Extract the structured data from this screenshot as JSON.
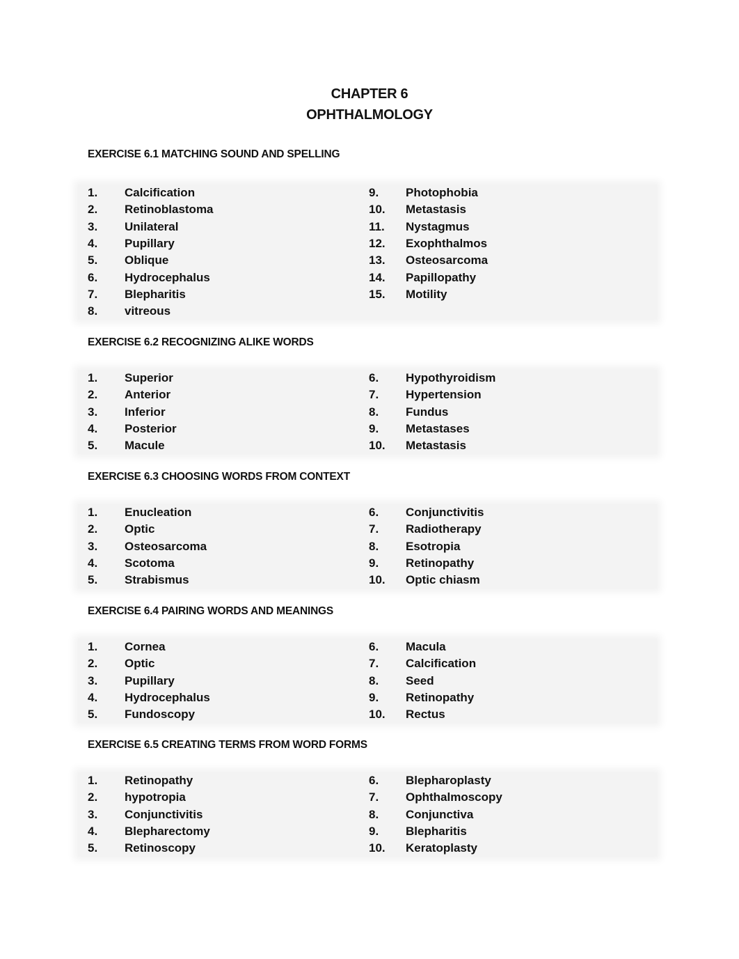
{
  "header": {
    "chapter": "CHAPTER 6",
    "subject": "OPHTHALMOLOGY"
  },
  "exercises": [
    {
      "title": "EXERCISE 6.1 MATCHING SOUND AND SPELLING",
      "left": [
        {
          "num": "1.",
          "term": "Calcification"
        },
        {
          "num": "2.",
          "term": "Retinoblastoma"
        },
        {
          "num": "3.",
          "term": "Unilateral"
        },
        {
          "num": "4.",
          "term": "Pupillary"
        },
        {
          "num": "5.",
          "term": "Oblique"
        },
        {
          "num": "6.",
          "term": "Hydrocephalus"
        },
        {
          "num": "7.",
          "term": "Blepharitis"
        },
        {
          "num": "8.",
          "term": "vitreous"
        }
      ],
      "right": [
        {
          "num": "9.",
          "term": "Photophobia"
        },
        {
          "num": "10.",
          "term": "Metastasis"
        },
        {
          "num": "11.",
          "term": "Nystagmus"
        },
        {
          "num": "12.",
          "term": "Exophthalmos"
        },
        {
          "num": "13.",
          "term": "Osteosarcoma"
        },
        {
          "num": "14.",
          "term": "Papillopathy"
        },
        {
          "num": "15.",
          "term": "Motility"
        },
        {
          "num": "",
          "term": ""
        }
      ]
    },
    {
      "title": "EXERCISE 6.2 RECOGNIZING ALIKE WORDS",
      "left": [
        {
          "num": "1.",
          "term": "Superior"
        },
        {
          "num": "2.",
          "term": "Anterior"
        },
        {
          "num": "3.",
          "term": "Inferior"
        },
        {
          "num": "4.",
          "term": "Posterior"
        },
        {
          "num": "5.",
          "term": "Macule"
        }
      ],
      "right": [
        {
          "num": "6.",
          "term": "Hypothyroidism"
        },
        {
          "num": "7.",
          "term": "Hypertension"
        },
        {
          "num": "8.",
          "term": "Fundus"
        },
        {
          "num": "9.",
          "term": "Metastases"
        },
        {
          "num": "10.",
          "term": "Metastasis"
        }
      ]
    },
    {
      "title": "EXERCISE 6.3 CHOOSING WORDS FROM CONTEXT",
      "left": [
        {
          "num": "1.",
          "term": "Enucleation"
        },
        {
          "num": "2.",
          "term": "Optic"
        },
        {
          "num": "3.",
          "term": "Osteosarcoma"
        },
        {
          "num": "4.",
          "term": "Scotoma"
        },
        {
          "num": "5.",
          "term": "Strabismus"
        }
      ],
      "right": [
        {
          "num": "6.",
          "term": "Conjunctivitis"
        },
        {
          "num": "7.",
          "term": "Radiotherapy"
        },
        {
          "num": "8.",
          "term": "Esotropia"
        },
        {
          "num": "9.",
          "term": "Retinopathy"
        },
        {
          "num": "10.",
          "term": "Optic chiasm"
        }
      ]
    },
    {
      "title": "EXERCISE 6.4 PAIRING WORDS AND MEANINGS",
      "left": [
        {
          "num": "1.",
          "term": "Cornea"
        },
        {
          "num": "2.",
          "term": "Optic"
        },
        {
          "num": "3.",
          "term": "Pupillary"
        },
        {
          "num": "4.",
          "term": "Hydrocephalus"
        },
        {
          "num": "5.",
          "term": "Fundoscopy"
        }
      ],
      "right": [
        {
          "num": "6.",
          "term": "Macula"
        },
        {
          "num": "7.",
          "term": "Calcification"
        },
        {
          "num": "8.",
          "term": "Seed"
        },
        {
          "num": "9.",
          "term": "Retinopathy"
        },
        {
          "num": "10.",
          "term": "Rectus"
        }
      ]
    },
    {
      "title": "EXERCISE 6.5 CREATING TERMS FROM WORD FORMS",
      "left": [
        {
          "num": "1.",
          "term": "Retinopathy"
        },
        {
          "num": "2.",
          "term": "hypotropia"
        },
        {
          "num": "3.",
          "term": "Conjunctivitis"
        },
        {
          "num": "4.",
          "term": "Blepharectomy"
        },
        {
          "num": "5.",
          "term": "Retinoscopy"
        }
      ],
      "right": [
        {
          "num": "6.",
          "term": "Blepharoplasty"
        },
        {
          "num": "7.",
          "term": "Ophthalmoscopy"
        },
        {
          "num": "8.",
          "term": "Conjunctiva"
        },
        {
          "num": "9.",
          "term": "Blepharitis"
        },
        {
          "num": "10.",
          "term": "Keratoplasty"
        }
      ]
    }
  ]
}
